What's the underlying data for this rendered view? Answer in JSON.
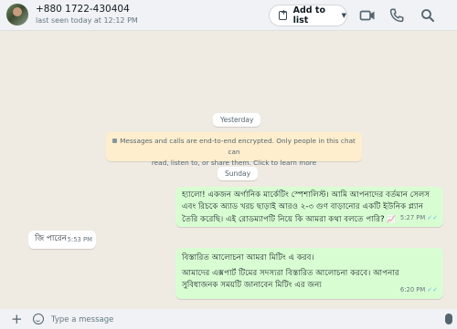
{
  "header": {
    "contact_name": "+880 1722-430404",
    "contact_status": "last seen today at 12:12 PM",
    "add_to_list_label": "Add to list",
    "icons": [
      "video-call-icon",
      "voice-call-icon",
      "search-icon"
    ]
  },
  "chat": {
    "date_yesterday": "Yesterday",
    "encryption_notice_line1": "Messages and calls are end-to-end encrypted. Only people in this chat can",
    "encryption_notice_line2": "read, listen to, or share them. Click to learn more",
    "date_sunday": "Sunday",
    "messages": [
      {
        "direction": "outgoing",
        "lines": [
          "হ্যালো! একজন অর্গানিক মার্কেটিং স্পেশালিস্ট। আমি আপনাদের বর্তমান সেলস",
          "এবং রিচকে অ্যাড খরচ ছাড়াই আরও ২-৩ গুণ বাড়ানোর একটি ইউনিক প্ল্যান",
          "তৈরি করেছি। এই রোডম্যাপটি নিয়ে কি আমরা কথা বলতে পারি?"
        ],
        "emoji": "📈",
        "time": "5:27 PM",
        "status": "read"
      },
      {
        "direction": "incoming",
        "lines": [
          "জি পারেন"
        ],
        "time": "5:53 PM"
      },
      {
        "direction": "outgoing",
        "lines": [
          "বিস্তারিত আলোচনা আমরা মিটিং এ করব।",
          "আমাদের এক্সপার্ট টিমের সদস্যরা বিস্তারিত আলোচনা করবে। আপনার",
          "সুবিধাজনক সময়টি জানাবেন মিটিং এর জন্য"
        ],
        "time": "6:20 PM",
        "status": "read"
      }
    ]
  },
  "composer": {
    "placeholder": "Type a message"
  },
  "colors": {
    "outgoing_bubble": "#d9fdd3",
    "incoming_bubble": "#ffffff",
    "chat_background": "#efeae2",
    "read_ticks": "#53bdeb"
  }
}
